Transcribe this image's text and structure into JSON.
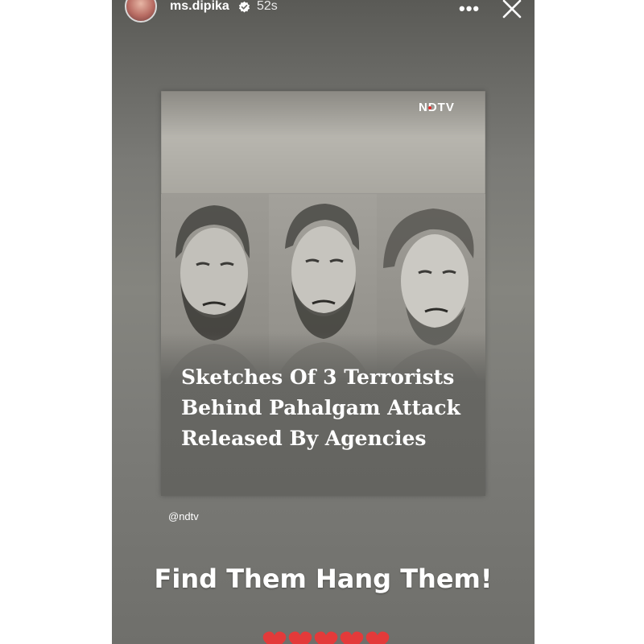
{
  "header": {
    "username": "ms.dipika",
    "time": "52s",
    "more_label": "•••"
  },
  "post": {
    "logo": "NDTV",
    "headline": "Sketches Of 3 Terrorists Behind Pahalgam Attack Released By Agencies",
    "credit": "@ndtv"
  },
  "caption": "Find Them Hang Them!",
  "stickers": {
    "heart_count": 5,
    "heart_icon": "red-heart-icon",
    "heart_color": "#e33a3a"
  },
  "colors": {
    "story_bg": "#7d7d79",
    "logo_dot": "#e02a2a"
  }
}
